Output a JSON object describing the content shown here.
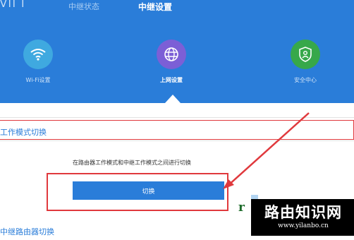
{
  "header": {
    "logo_fragment": "VII I",
    "tabs": [
      {
        "label": "中继状态"
      },
      {
        "label": "中继设置"
      }
    ],
    "nav": [
      {
        "label": "Wi-Fi设置",
        "icon": "wifi-icon",
        "color": "#3fa9e0"
      },
      {
        "label": "上网设置",
        "icon": "globe-icon",
        "color": "#7c5fd6"
      },
      {
        "label": "安全中心",
        "icon": "shield-icon",
        "color": "#37a84a"
      }
    ],
    "background": "#2a7dd9"
  },
  "main": {
    "section1_title": "工作模式切换",
    "description": "在路由器工作模式和中继工作模式之间进行切换",
    "switch_button": "切换",
    "section2_title": "中继路由器切换"
  },
  "annotation_color": "#e0393d",
  "watermark": {
    "title": "路由知识网",
    "url": "www.yilanbo.cn",
    "r_letter": "r"
  }
}
